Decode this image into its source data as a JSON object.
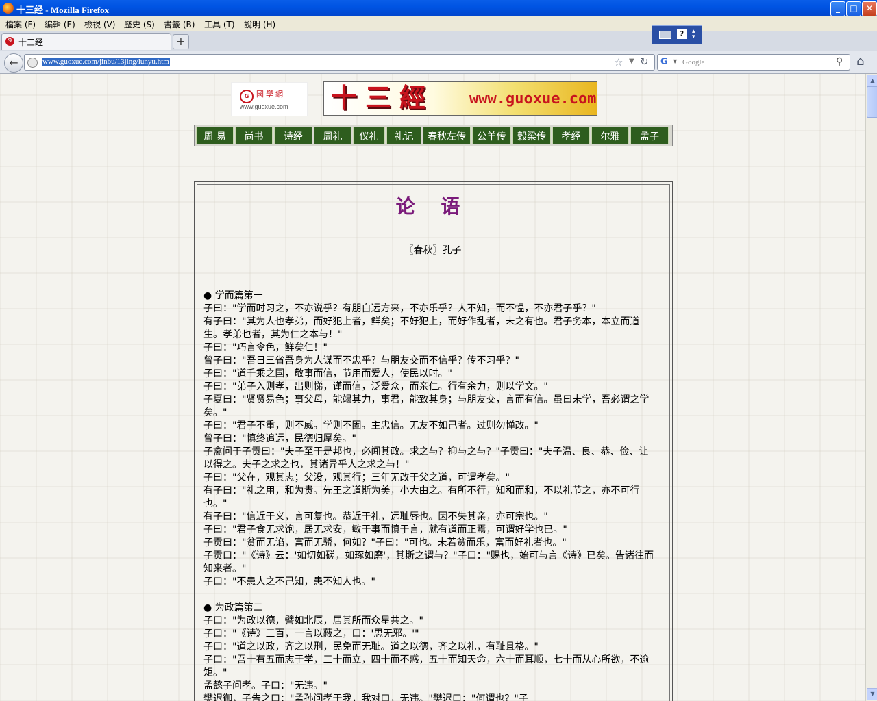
{
  "window": {
    "title": "十三经 - Mozilla Firefox",
    "min": "_",
    "max": "□",
    "close": "✕"
  },
  "menu": {
    "items": [
      "檔案 (F)",
      "編輯 (E)",
      "檢視 (V)",
      "歷史 (S)",
      "書籤 (B)",
      "工具 (T)",
      "說明 (H)"
    ]
  },
  "tab": {
    "label": "十三经",
    "new": "+"
  },
  "nav": {
    "url": "www.guoxue.com/jinbu/13jing/lunyu.htm",
    "search_placeholder": "Google"
  },
  "page": {
    "logo_text": "國學網",
    "logo_domain": "www.guoxue.com",
    "banner_title": "十三經",
    "banner_url": "www.guoxue.com",
    "menu": [
      "周 易",
      "尚书",
      "诗经",
      "周礼",
      "仪礼",
      "礼记",
      "春秋左传",
      "公羊传",
      "穀梁传",
      "孝经",
      "尔雅",
      "孟子"
    ],
    "title": "论 语",
    "author": "〖春秋〗孔子",
    "chapter1_heading": "● 学而篇第一",
    "chapter1_lines": [
      "子曰：\"学而时习之，不亦说乎？有朋自远方来，不亦乐乎？人不知，而不愠，不亦君子乎？\"",
      "有子曰：\"其为人也孝弟，而好犯上者，鲜矣；不好犯上，而好作乱者，未之有也。君子务本，本立而道生。孝弟也者，其为仁之本与！\"",
      "子曰：\"巧言令色，鲜矣仁！\"",
      "曾子曰：\"吾日三省吾身为人谋而不忠乎？与朋友交而不信乎？传不习乎？\"",
      "子曰：\"道千乘之国，敬事而信，节用而爱人，使民以时。\"",
      "子曰：\"弟子入则孝，出则悌，谨而信，泛爱众，而亲仁。行有余力，则以学文。\"",
      "子夏曰：\"贤贤易色；事父母，能竭其力，事君，能致其身；与朋友交，言而有信。虽曰未学，吾必谓之学矣。\"",
      "子曰：\"君子不重，则不威。学则不固。主忠信。无友不如己者。过则勿惮改。\"",
      "曾子曰：\"慎终追远，民德归厚矣。\"",
      "子禽问于子贡曰：\"夫子至于是邦也，必闻其政。求之与？抑与之与？\"子贡曰：\"夫子温、良、恭、俭、让以得之。夫子之求之也，其诸异乎人之求之与！\"",
      "子曰：\"父在，观其志；父没，观其行；三年无改于父之道，可谓孝矣。\"",
      "有子曰：\"礼之用，和为贵。先王之道斯为美，小大由之。有所不行，知和而和，不以礼节之，亦不可行也。\"",
      "有子曰：\"信近于义，言可复也。恭近于礼，远耻辱也。因不失其亲，亦可宗也。\"",
      "子曰：\"君子食无求饱，居无求安，敏于事而慎于言，就有道而正焉，可谓好学也已。\"",
      "子贡曰：\"贫而无谄，富而无骄，何如？\"子曰：\"可也。未若贫而乐，富而好礼者也。\"",
      "子贡曰：\"《诗》云：'如切如磋，如琢如磨'，其斯之谓与？\"子曰：\"赐也，始可与言《诗》已矣。告诸往而知来者。\"",
      "子曰：\"不患人之不己知，患不知人也。\""
    ],
    "chapter2_heading": "● 为政篇第二",
    "chapter2_lines": [
      "子曰：\"为政以德，譬如北辰，居其所而众星共之。\"",
      "子曰：\"《诗》三百，一言以蔽之，曰：'思无邪。'\"",
      "子曰：\"道之以政，齐之以刑，民免而无耻。道之以德，齐之以礼，有耻且格。\"",
      "子曰：\"吾十有五而志于学，三十而立，四十而不惑，五十而知天命，六十而耳顺，七十而从心所欲，不逾矩。\"",
      "孟懿子问孝。子曰：\"无违。\"",
      "樊迟御，子告之曰：\"孟孙问孝于我，我对曰，无违。\"樊迟曰：\"何谓也？\"子"
    ]
  }
}
